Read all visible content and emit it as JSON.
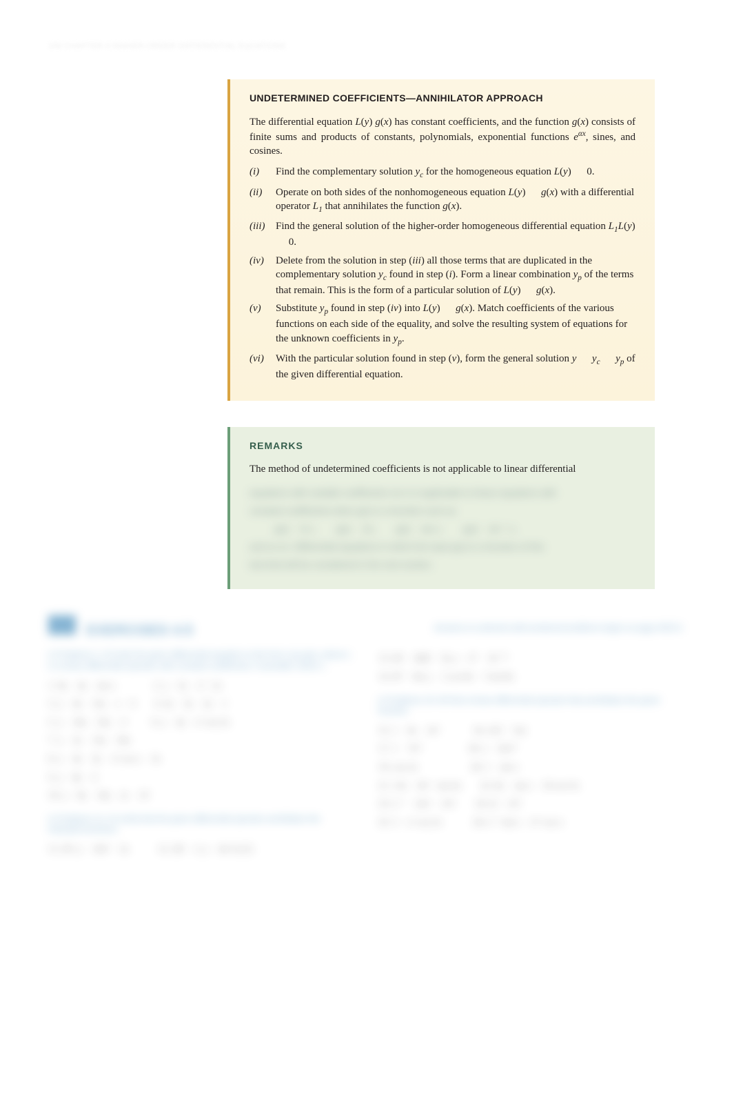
{
  "running_head": "156      CHAPTER 4    HIGHER-ORDER DIFFERENTIAL EQUATIONS",
  "box_method": {
    "title": "UNDETERMINED COEFFICIENTS—ANNIHILATOR APPROACH",
    "lead_before": "The differential equation ",
    "lead_eq1_L": "L",
    "lead_eq1_y": "y",
    "lead_eq_gap": "     ",
    "lead_eq1_g": "g",
    "lead_eq1_x": "x",
    "lead_mid": " has constant coefficients, and the function ",
    "lead_gx_g": "g",
    "lead_gx_x": "x",
    "lead_after": " consists of finite sums and products of constants, polynomials, exponential functions ",
    "lead_exp_e": "e",
    "lead_exp_ax": "αx",
    "lead_tail": ", sines, and cosines.",
    "steps": [
      {
        "num": "i",
        "body": "Find the complementary solution {yc} for the homogeneous equation {Ly} {gap} 0."
      },
      {
        "num": "ii",
        "body": "Operate on both sides of the nonhomogeneous equation {Ly} {gap} {gx} with a differential operator {L1} that annihilates the function {gx}."
      },
      {
        "num": "iii",
        "body": "Find the general solution of the higher-order homogeneous differential equation {L1Ly} {gap} 0."
      },
      {
        "num": "iv",
        "body": "Delete from the solution in step ({iii}) all those terms that are duplicated in the complementary solution {yc} found in step ({i}). Form a linear combination {yp} of the terms that remain. This is the form of a particular solution of {Ly} {gap} {gx}."
      },
      {
        "num": "v",
        "body": "Substitute {yp} found in step ({iv}) into {Ly} {gap} {gx}. Match coefficients of the various functions on each side of the equality, and solve the resulting system of equations for the unknown coefficients in {ypplain}."
      },
      {
        "num": "vi",
        "body": "With the particular solution found in step ({v}), form the general solution {y} {gap} {ycplain} {gap} {ypplain} of the given differential equation."
      }
    ]
  },
  "box_remarks": {
    "title": "REMARKS",
    "visible": "The method of undetermined coefficients is not applicable to linear differential",
    "blurred": [
      "equations with variable coefficients nor is it applicable to linear equations with",
      "constant coefficients when g(x) is a function such as",
      "          g(x)    ln x,        g(x)    1/x,        g(x)    tan x,        g(x)    sin⁻¹ x,",
      "and so on. Differential equations in which the input g(x) is a function of this",
      "last kind will be considered in the next section."
    ]
  },
  "exercises": {
    "title": "EXERCISES 4.5",
    "answers_note": "Answers to selected odd-numbered problems begin on page ANS-5.",
    "left": {
      "instr1": "In Problems 1–10 write the given differential equation in the form L(y)   g(x), where L is a linear differential operator with constant coefficients. If possible, factor L.",
      "items1": [
        "1. 9y    4y    sin x                2. y    5y    x²   2x",
        "3. y    4y    12y    x    6        4. 2y    3y    2y    1",
        "5. y    10y    25y    eˣ          6. y    4y    eˣ cos 2x",
        "7. y    2y    13y    10y",
        "8. y    4y    3y    x² cos x    3x",
        "9. y    8y    4",
        "10. y    8y    16y    (x    1)²"
      ],
      "instr2": "In Problems 11–14 verify that the given differential operator annihilates the indicated functions.",
      "items2": [
        "11. D⁴; y    10x³    2x            12. 2D    1; y    4e^{x/2}"
      ]
    },
    "right": {
      "items_top": [
        "13. (D    2)(D    5); y    e²ˣ    3e⁻⁵ˣ",
        "14. D²    64; y    2 cos 8x    5 sin 8x"
      ],
      "instr": "In Problems 15–26 find a linear differential operator that annihilates the given function.",
      "items": [
        "15. 1    6x    2x³              16. x³(1    5x)",
        "17. 1    7e²ˣ                   18. x    3xe⁶ˣ",
        "19. cos 2x                      20. 1    sin x",
        "21. 13x    9x² · sin 4x        22. 8x    sin x    10 cos 5x",
        "23. e⁻ˣ    2xeˣ    x²eˣ        24. (2    eˣ)²",
        "25. 3    eˣ cos 2x             26. e⁻ˣ sin x    e²ˣ cos x"
      ]
    }
  }
}
